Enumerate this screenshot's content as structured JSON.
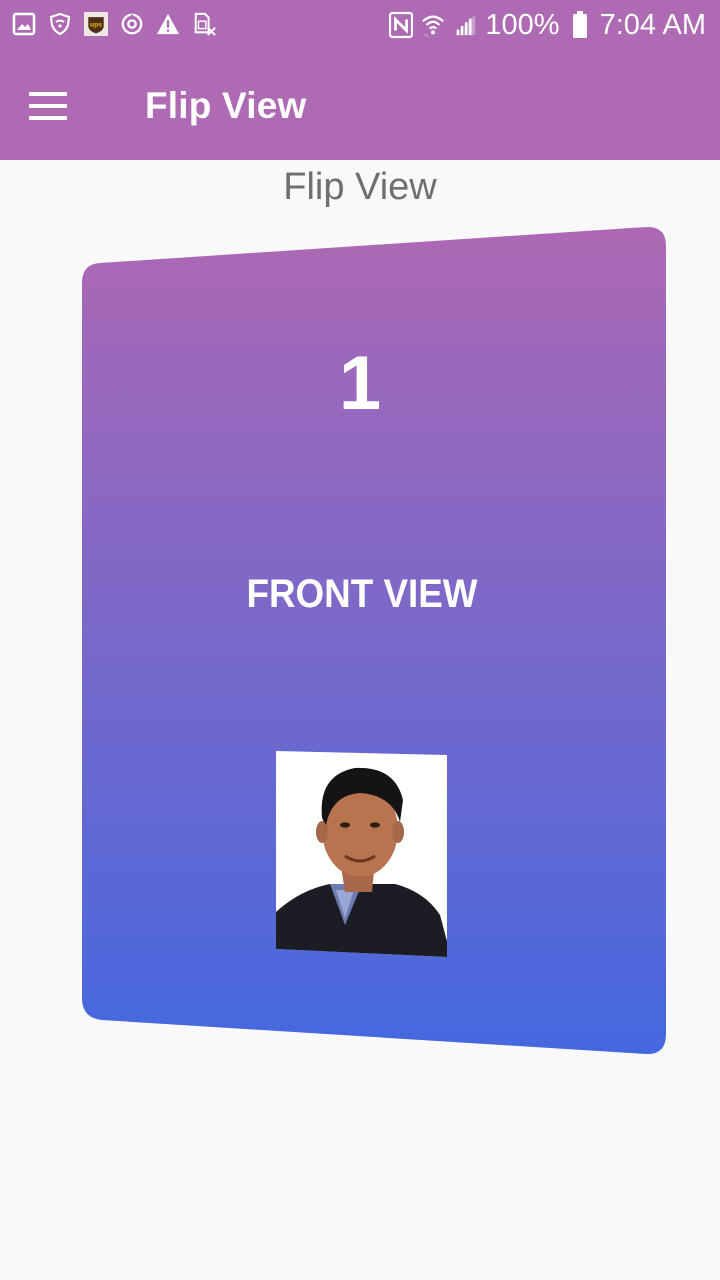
{
  "status_bar": {
    "left_icons": [
      "gallery-icon",
      "shield-wifi-icon",
      "ups-icon",
      "sync-icon",
      "warning-icon",
      "sim-off-icon"
    ],
    "nfc_icon": "nfc-icon",
    "wifi_icon": "wifi-icon",
    "signal_icon": "signal-icon",
    "battery_percent": "100%",
    "battery_icon": "battery-icon",
    "time": "7:04 AM"
  },
  "app_bar": {
    "menu_icon": "hamburger-menu-icon",
    "title": "Flip View"
  },
  "content": {
    "heading": "Flip View",
    "card": {
      "number": "1",
      "label": "FRONT VIEW",
      "gradient_top": "#ad68b4",
      "gradient_bottom": "#4468e0"
    }
  },
  "colors": {
    "app_bar": "#ae6ab2",
    "background": "#f9f9f9",
    "heading_text": "#6f6f6f"
  }
}
